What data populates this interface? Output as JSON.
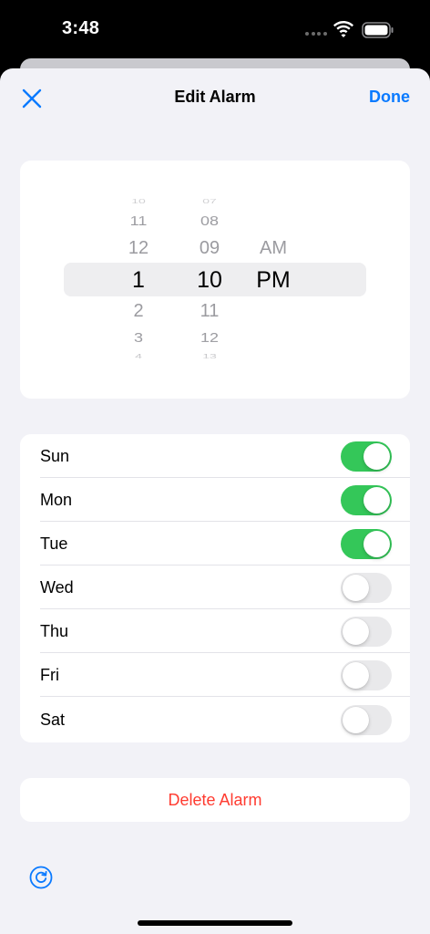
{
  "status_bar": {
    "time": "3:48"
  },
  "nav": {
    "title": "Edit Alarm",
    "done_label": "Done"
  },
  "picker": {
    "hours": [
      "10",
      "11",
      "12",
      "1",
      "2",
      "3",
      "4"
    ],
    "minutes": [
      "07",
      "08",
      "09",
      "10",
      "11",
      "12",
      "13"
    ],
    "ampm": [
      "AM",
      "PM"
    ],
    "selected": {
      "hour": "1",
      "minute": "10",
      "period": "PM"
    }
  },
  "days": [
    {
      "label": "Sun",
      "on": true
    },
    {
      "label": "Mon",
      "on": true
    },
    {
      "label": "Tue",
      "on": true
    },
    {
      "label": "Wed",
      "on": false
    },
    {
      "label": "Thu",
      "on": false
    },
    {
      "label": "Fri",
      "on": false
    },
    {
      "label": "Sat",
      "on": false
    }
  ],
  "delete_label": "Delete Alarm",
  "colors": {
    "accent": "#0a7aff",
    "toggle_on": "#34c759",
    "destructive": "#ff3b30"
  }
}
